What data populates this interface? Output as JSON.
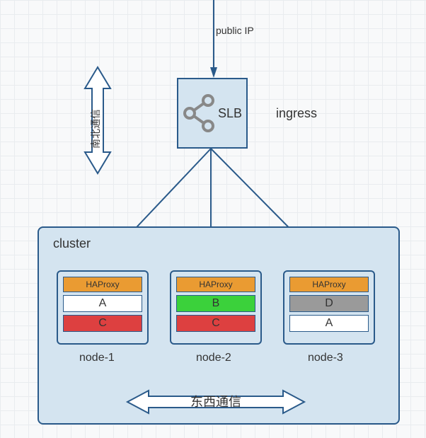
{
  "labels": {
    "publicIP": "public IP",
    "slb": "SLB",
    "ingress": "ingress",
    "northSouth": "南北通信",
    "cluster": "cluster",
    "haproxy": "HAProxy",
    "eastWest": "东西通信"
  },
  "nodes": [
    {
      "name": "node-1",
      "services": [
        {
          "label": "A",
          "color": "white"
        },
        {
          "label": "C",
          "color": "red"
        }
      ]
    },
    {
      "name": "node-2",
      "services": [
        {
          "label": "B",
          "color": "green"
        },
        {
          "label": "C",
          "color": "red"
        }
      ]
    },
    {
      "name": "node-3",
      "services": [
        {
          "label": "D",
          "color": "gray"
        },
        {
          "label": "A",
          "color": "white"
        }
      ]
    }
  ]
}
